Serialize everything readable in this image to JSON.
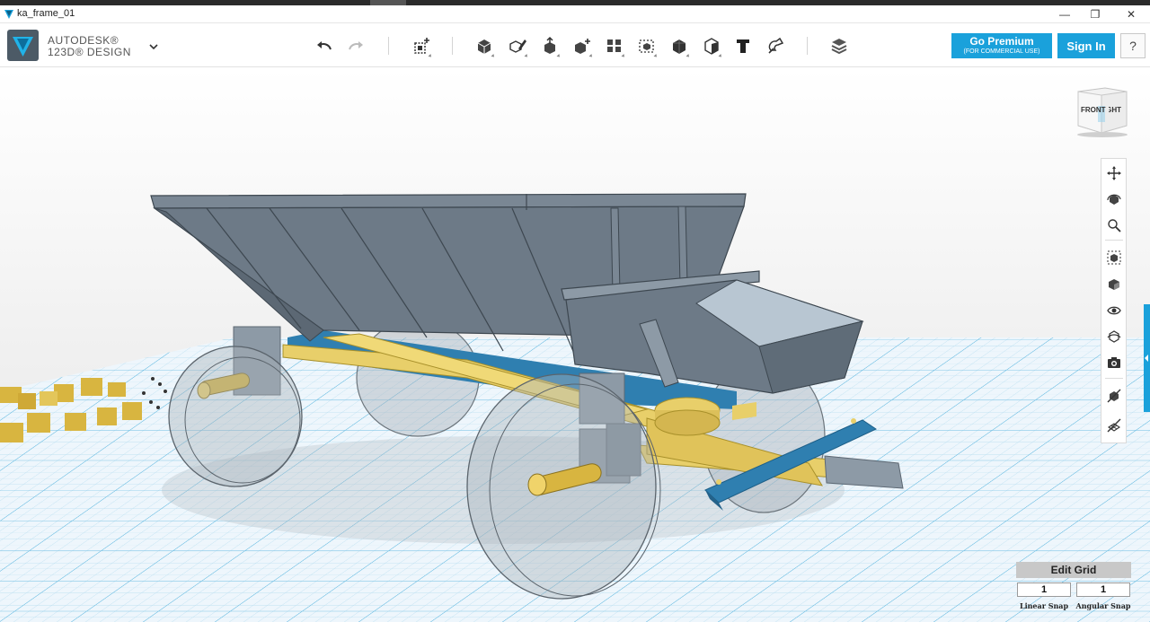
{
  "window": {
    "title": "ka_frame_01",
    "controls": {
      "minimize": "—",
      "maximize": "❐",
      "close": "✕"
    }
  },
  "app": {
    "logo_line1": "AUTODESK®",
    "logo_line2": "123D® DESIGN"
  },
  "toolbar": {
    "tools": [
      {
        "name": "undo-icon"
      },
      {
        "name": "redo-icon"
      },
      {
        "name": "transform-icon"
      },
      {
        "name": "primitives-icon"
      },
      {
        "name": "sketch-icon"
      },
      {
        "name": "construct-icon"
      },
      {
        "name": "modify-icon"
      },
      {
        "name": "pattern-icon"
      },
      {
        "name": "group-icon"
      },
      {
        "name": "combine-icon"
      },
      {
        "name": "measure-icon"
      },
      {
        "name": "text-icon"
      },
      {
        "name": "snap-icon"
      },
      {
        "name": "material-icon"
      }
    ]
  },
  "account": {
    "go_premium": "Go Premium",
    "go_premium_sub": "(FOR COMMERCIAL USE)",
    "sign_in": "Sign In",
    "help": "?"
  },
  "viewcube": {
    "front": "FRONT",
    "right": "RIGHT"
  },
  "navbar": {
    "tools": [
      "pan-icon",
      "orbit-icon",
      "zoom-icon",
      "fit-icon",
      "view-mode-icon",
      "visibility-icon",
      "materials-display-icon",
      "camera-icon",
      "outline-icon",
      "grid-toggle-icon"
    ]
  },
  "grid": {
    "edit_label": "Edit Grid",
    "linear_snap_value": "1",
    "angular_snap_value": "1",
    "linear_snap_label": "Linear Snap",
    "angular_snap_label": "Angular Snap"
  },
  "colors": {
    "accent": "#1aa1db",
    "grid_bg": "#eef5fb",
    "grid_line": "#9ed3ec",
    "wagon_body": "#6e7b88",
    "wagon_frame": "#e8cf6a",
    "wagon_blue": "#2f7fb0"
  }
}
